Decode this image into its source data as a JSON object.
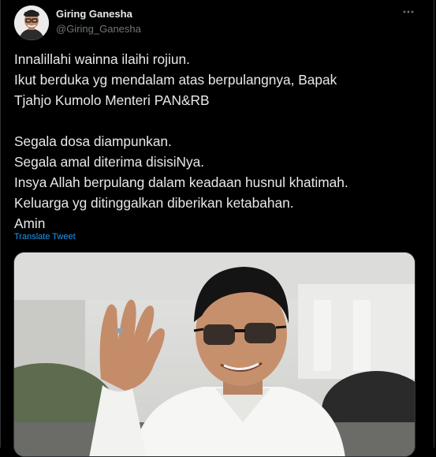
{
  "author": {
    "name": "Giring Ganesha",
    "handle": "@Giring_Ganesha"
  },
  "tweet": {
    "lines_block1": [
      "Innalillahi wainna ilaihi rojiun.",
      "Ikut berduka yg mendalam atas berpulangnya, Bapak",
      "Tjahjo Kumolo Menteri PAN&RB"
    ],
    "lines_block2": [
      "Segala dosa diampunkan.",
      "Segala amal diterima disisiNya.",
      "Insya Allah berpulang dalam keadaan husnul khatimah.",
      "Keluarga yg ditinggalkan diberikan ketabahan.",
      "Amin"
    ],
    "translate_label": "Translate Tweet"
  },
  "icons": {
    "more": "more-horizontal-icon",
    "avatar": "avatar"
  },
  "colors": {
    "background": "#000000",
    "text": "#e7e9ea",
    "secondary": "#71767b",
    "link": "#1d9bf0"
  }
}
